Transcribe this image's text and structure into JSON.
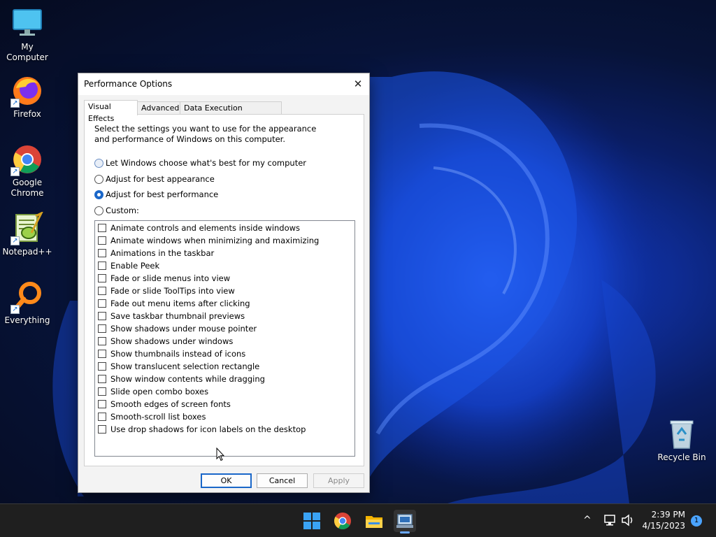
{
  "desktop": {
    "icons": [
      {
        "label": "My Computer"
      },
      {
        "label": "Firefox"
      },
      {
        "label": "Google Chrome"
      },
      {
        "label": "Notepad++"
      },
      {
        "label": "Everything"
      },
      {
        "label": "Recycle Bin"
      }
    ]
  },
  "dialog": {
    "title": "Performance Options",
    "close_glyph": "✕",
    "tabs": [
      {
        "label": "Visual Effects",
        "active": true
      },
      {
        "label": "Advanced",
        "active": false
      },
      {
        "label": "Data Execution Prevention",
        "active": false
      }
    ],
    "description": "Select the settings you want to use for the appearance and performance of Windows on this computer.",
    "radios": [
      {
        "label": "Let Windows choose what's best for my computer",
        "checked": false
      },
      {
        "label": "Adjust for best appearance",
        "checked": false
      },
      {
        "label": "Adjust for best performance",
        "checked": true
      },
      {
        "label": "Custom:",
        "checked": false
      }
    ],
    "checkboxes": [
      {
        "label": "Animate controls and elements inside windows",
        "checked": false
      },
      {
        "label": "Animate windows when minimizing and maximizing",
        "checked": false
      },
      {
        "label": "Animations in the taskbar",
        "checked": false
      },
      {
        "label": "Enable Peek",
        "checked": false
      },
      {
        "label": "Fade or slide menus into view",
        "checked": false
      },
      {
        "label": "Fade or slide ToolTips into view",
        "checked": false
      },
      {
        "label": "Fade out menu items after clicking",
        "checked": false
      },
      {
        "label": "Save taskbar thumbnail previews",
        "checked": false
      },
      {
        "label": "Show shadows under mouse pointer",
        "checked": false
      },
      {
        "label": "Show shadows under windows",
        "checked": false
      },
      {
        "label": "Show thumbnails instead of icons",
        "checked": false
      },
      {
        "label": "Show translucent selection rectangle",
        "checked": false
      },
      {
        "label": "Show window contents while dragging",
        "checked": false
      },
      {
        "label": "Slide open combo boxes",
        "checked": false
      },
      {
        "label": "Smooth edges of screen fonts",
        "checked": false
      },
      {
        "label": "Smooth-scroll list boxes",
        "checked": false
      },
      {
        "label": "Use drop shadows for icon labels on the desktop",
        "checked": false
      }
    ],
    "buttons": {
      "ok": "OK",
      "cancel": "Cancel",
      "apply": "Apply"
    }
  },
  "taskbar": {
    "apps": [
      {
        "icon": "windows-start-icon"
      },
      {
        "icon": "chrome-icon"
      },
      {
        "icon": "file-explorer-icon"
      },
      {
        "icon": "system-properties-icon",
        "active": true
      }
    ],
    "tray": {
      "chevron_glyph": "^",
      "icons": [
        "network-icon",
        "volume-icon"
      ],
      "time": "2:39 PM",
      "date": "4/15/2023",
      "notification_count": "1"
    }
  },
  "colors": {
    "accent": "#1a67c9",
    "taskbar": "#1f1f1f",
    "wallpaper": "#0a1d63"
  }
}
